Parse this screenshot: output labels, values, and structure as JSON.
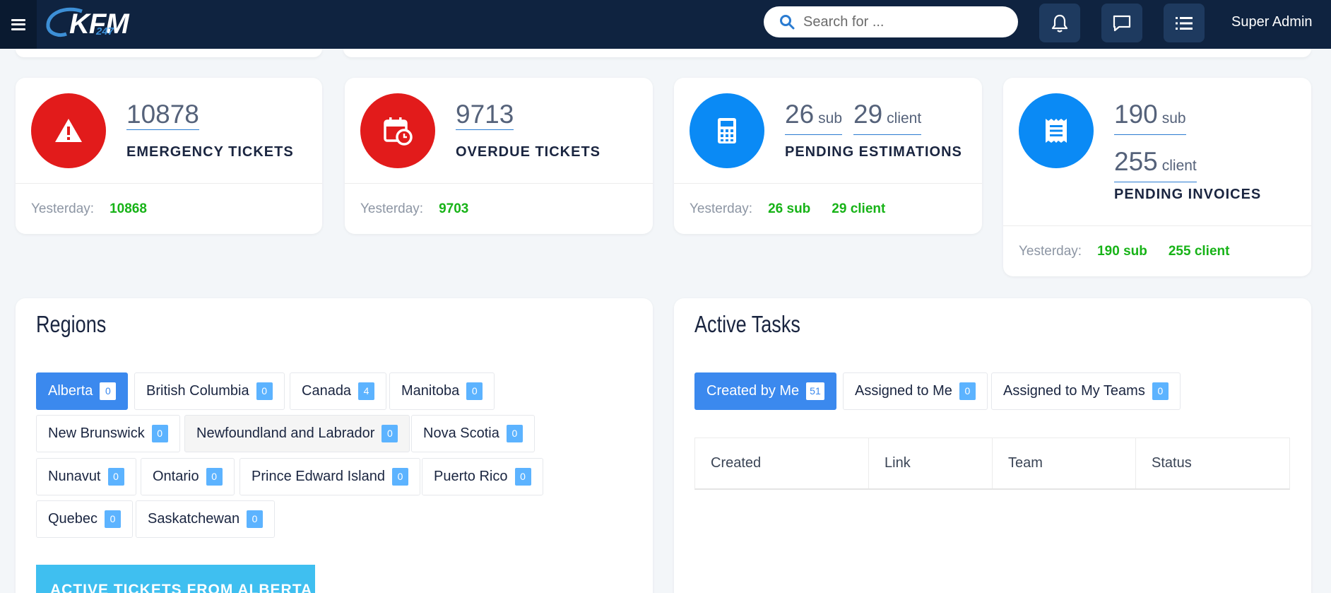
{
  "topbar": {
    "logo_text": "KFM",
    "logo_sub": "247",
    "search_placeholder": "Search for ...",
    "user_name": "Super Admin",
    "icons": [
      "menu-icon",
      "bell-icon",
      "chat-icon",
      "list-icon",
      "search-icon"
    ]
  },
  "stats": [
    {
      "value": "10878",
      "label": "EMERGENCY TICKETS",
      "yesterday_label": "Yesterday:",
      "yesterday_value": "10868",
      "icon": "warning-icon",
      "color": "#e21b1b"
    },
    {
      "value": "9713",
      "label": "OVERDUE TICKETS",
      "yesterday_label": "Yesterday:",
      "yesterday_value": "9703",
      "icon": "calendar-clock-icon",
      "color": "#e21b1b"
    },
    {
      "sub_value": "26",
      "sub_unit": "sub",
      "client_value": "29",
      "client_unit": "client",
      "label": "PENDING ESTIMATIONS",
      "yesterday_label": "Yesterday:",
      "yesterday_sub": "26 sub",
      "yesterday_client": "29 client",
      "icon": "calculator-icon",
      "color": "#0a8af5"
    },
    {
      "sub_value": "190",
      "sub_unit": "sub",
      "client_value": "255",
      "client_unit": "client",
      "label": "PENDING INVOICES",
      "yesterday_label": "Yesterday:",
      "yesterday_sub": "190 sub",
      "yesterday_client": "255 client",
      "icon": "receipt-icon",
      "color": "#0a8af5"
    }
  ],
  "regions": {
    "title": "Regions",
    "items": [
      {
        "name": "Alberta",
        "count": "0"
      },
      {
        "name": "British Columbia",
        "count": "0"
      },
      {
        "name": "Canada",
        "count": "4"
      },
      {
        "name": "Manitoba",
        "count": "0"
      },
      {
        "name": "New Brunswick",
        "count": "0"
      },
      {
        "name": "Newfoundland and Labrador",
        "count": "0"
      },
      {
        "name": "Nova Scotia",
        "count": "0"
      },
      {
        "name": "Nunavut",
        "count": "0"
      },
      {
        "name": "Ontario",
        "count": "0"
      },
      {
        "name": "Prince Edward Island",
        "count": "0"
      },
      {
        "name": "Puerto Rico",
        "count": "0"
      },
      {
        "name": "Quebec",
        "count": "0"
      },
      {
        "name": "Saskatchewan",
        "count": "0"
      }
    ],
    "selected": "Alberta",
    "cta_label": "ACTIVE TICKETS FROM ALBERTA"
  },
  "tasks": {
    "title": "Active Tasks",
    "tabs": [
      {
        "label": "Created by Me",
        "count": "51"
      },
      {
        "label": "Assigned to Me",
        "count": "0"
      },
      {
        "label": "Assigned to My Teams",
        "count": "0"
      }
    ],
    "columns": [
      "Created",
      "Link",
      "Team",
      "Status"
    ]
  }
}
